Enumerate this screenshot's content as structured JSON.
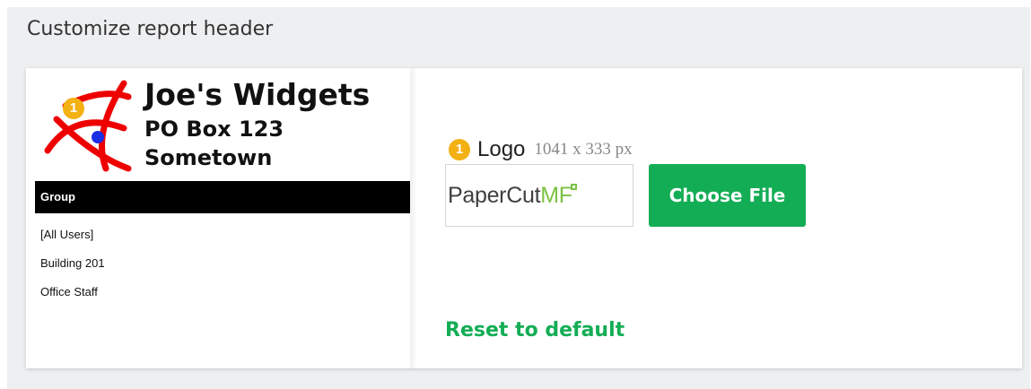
{
  "panel": {
    "title": "Customize report header"
  },
  "preview": {
    "badge": "1",
    "company_name": "Joe's Widgets",
    "address_line1": "PO Box 123",
    "address_line2": "Sometown",
    "group_header": "Group",
    "rows": [
      "[All Users]",
      "Building 201",
      "Office Staff"
    ]
  },
  "logo": {
    "badge": "1",
    "label": "Logo",
    "dimensions": "1041 x 333 px",
    "thumbnail_text": "PaperCut",
    "thumbnail_suffix": "MF",
    "choose_button": "Choose File",
    "reset_link": "Reset to default"
  },
  "colors": {
    "accent_green": "#13ad55",
    "badge_yellow": "#f3b114",
    "panel_bg": "#eeeff1"
  }
}
